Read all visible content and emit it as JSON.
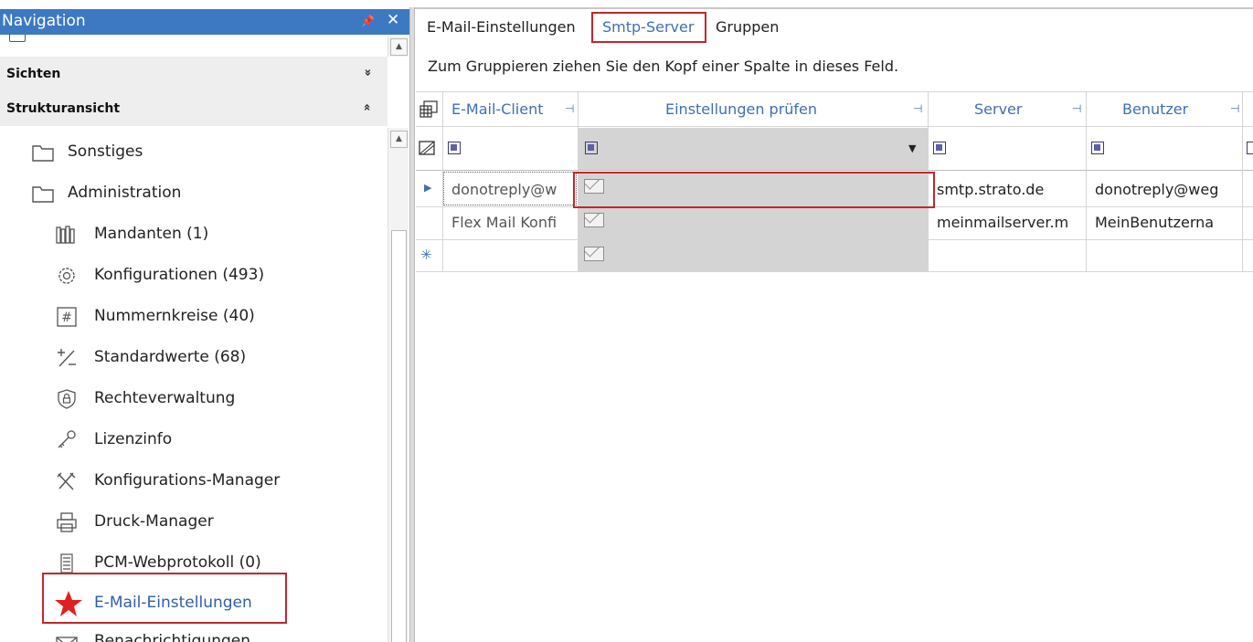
{
  "nav": {
    "title": "Navigation",
    "pin_glyph": "ह",
    "close_glyph": "✕",
    "sections": [
      {
        "label": "Sichten",
        "chevron": "»",
        "state": "collapsed"
      },
      {
        "label": "Strukturansicht",
        "chevron": "»",
        "state": "expanded"
      }
    ],
    "folders": [
      {
        "label": "Sonstiges",
        "icon": "folder-icon"
      },
      {
        "label": "Administration",
        "icon": "folder-icon"
      }
    ],
    "items": [
      {
        "label": "Mandanten (1)",
        "icon": "books-icon"
      },
      {
        "label": "Konfigurationen (493)",
        "icon": "gear-icon"
      },
      {
        "label": "Nummernkreise (40)",
        "icon": "hash-icon"
      },
      {
        "label": "Standardwerte (68)",
        "icon": "plus-minus-icon"
      },
      {
        "label": "Rechteverwaltung",
        "icon": "shield-lock-icon"
      },
      {
        "label": "Lizenzinfo",
        "icon": "key-icon"
      },
      {
        "label": "Konfigurations-Manager",
        "icon": "tools-icon"
      },
      {
        "label": "Druck-Manager",
        "icon": "printer-icon"
      },
      {
        "label": "PCM-Webprotokoll (0)",
        "icon": "list-doc-icon"
      },
      {
        "label": "E-Mail-Einstellungen",
        "icon": "star-icon",
        "selected": true
      },
      {
        "label": "Benachrichtigungen",
        "icon": "envelope-icon"
      }
    ]
  },
  "tabs": [
    {
      "label": "E-Mail-Einstellungen"
    },
    {
      "label": "Smtp-Server",
      "active": true
    },
    {
      "label": "Gruppen"
    }
  ],
  "grid": {
    "group_hint": "Zum Gruppieren ziehen Sie den Kopf einer Spalte in dieses Feld.",
    "columns": [
      {
        "label": "E-Mail-Client"
      },
      {
        "label": "Einstellungen prüfen"
      },
      {
        "label": "Server"
      },
      {
        "label": "Benutzer"
      }
    ],
    "rows": [
      {
        "client": "donotreply@w",
        "check": "envelope-icon",
        "server": "smtp.strato.de",
        "user": "donotreply@weg",
        "current": true
      },
      {
        "client": "Flex Mail Konfi",
        "check": "envelope-icon",
        "server": "meinmailserver.m",
        "user": "MeinBenutzerna"
      },
      {
        "client": "",
        "check": "envelope-icon",
        "server": "",
        "user": "",
        "new_row": true
      }
    ],
    "new_row_glyph": "✳",
    "current_row_glyph": "▶",
    "dropdown_glyph": "▼"
  },
  "colors": {
    "nav_header": "#3d79c2",
    "highlight_red": "#c1272d",
    "link_blue": "#3f6fb3",
    "star_red": "#e02020"
  }
}
